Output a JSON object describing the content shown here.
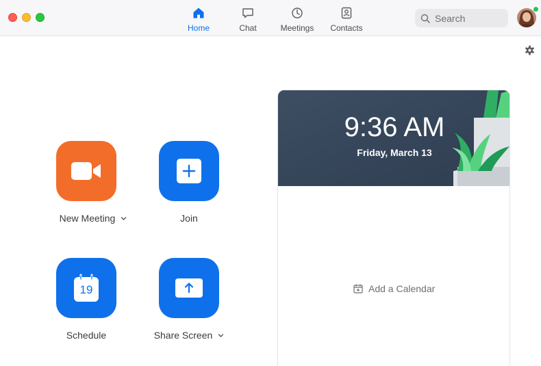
{
  "window": {
    "controls": [
      "close",
      "minimize",
      "maximize"
    ]
  },
  "nav": {
    "items": [
      {
        "label": "Home",
        "icon": "home-icon",
        "active": true
      },
      {
        "label": "Chat",
        "icon": "chat-bubble-icon",
        "active": false
      },
      {
        "label": "Meetings",
        "icon": "clock-icon",
        "active": false
      },
      {
        "label": "Contacts",
        "icon": "contact-card-icon",
        "active": false
      }
    ]
  },
  "search": {
    "placeholder": "Search"
  },
  "colors": {
    "accent": "#0e71eb",
    "new_meeting": "#f26d2a",
    "presence": "#22c45a",
    "card_header": "#36465a"
  },
  "actions": {
    "new_meeting": {
      "label": "New Meeting",
      "icon": "video-camera-icon"
    },
    "join": {
      "label": "Join",
      "icon": "plus-icon"
    },
    "schedule": {
      "label": "Schedule",
      "icon": "calendar-icon",
      "day": "19"
    },
    "share_screen": {
      "label": "Share Screen",
      "icon": "share-arrow-icon"
    }
  },
  "calendar_card": {
    "time": "9:36 AM",
    "date": "Friday, March 13",
    "add_calendar": "Add a Calendar"
  }
}
